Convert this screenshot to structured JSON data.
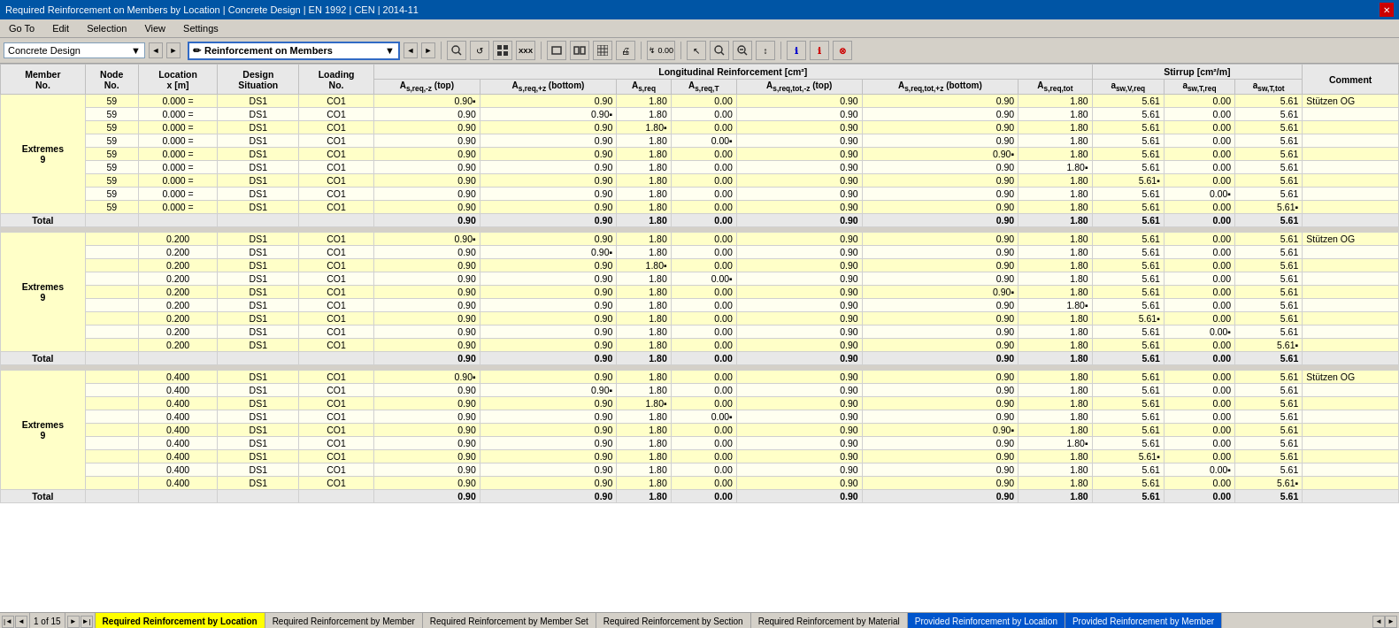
{
  "titleBar": {
    "title": "Required Reinforcement on Members by Location | Concrete Design | EN 1992 | CEN | 2014-11"
  },
  "menuBar": {
    "items": [
      "Go To",
      "Edit",
      "Selection",
      "View",
      "Settings"
    ]
  },
  "toolbar": {
    "dropdown1": "Concrete Design",
    "dropdown2": "Reinforcement on Members",
    "buttons": [
      "⌕",
      "↺",
      "⊞",
      "×××",
      "▭",
      "▭▭",
      "▦",
      "▨",
      "↯",
      "0.00",
      "↖",
      "🔍",
      "🔍",
      "↕",
      "ℹ",
      "ℹ",
      "⊗"
    ]
  },
  "table": {
    "groupHeaders": [
      {
        "label": "Longitudinal Reinforcement [cm²]",
        "colspan": 6
      },
      {
        "label": "Stirrup [cm²/m]",
        "colspan": 3
      }
    ],
    "columns": [
      "Member No.",
      "Node No.",
      "Location x [m]",
      "Design Situation",
      "Loading No.",
      "As,req,-z (top)",
      "As,req,+z (bottom)",
      "As,req",
      "As,req,T",
      "As,req,tot,-z (top)",
      "As,req,tot,+z (bottom)",
      "As,req,tot",
      "asw,V,req",
      "asw,T,req",
      "asw,T,tot",
      "Comment"
    ],
    "sections": [
      {
        "extremes": "Extremes",
        "memberNo": "9",
        "location": "0.000",
        "rows": [
          {
            "node": "59",
            "loc": "0.000 =",
            "ds": "DS1",
            "load": "CO1",
            "asTopReq": "0.90",
            "asBot": "0.90",
            "asReq": "1.80",
            "asT": "0.00",
            "asTopTot": "0.90",
            "asBotTot": "0.90",
            "asTot": "1.80",
            "aswV": "5.61",
            "aswT": "0.00",
            "aswTot": "5.61",
            "comment": "Stützen OG",
            "indTop": true
          },
          {
            "node": "59",
            "loc": "0.000 =",
            "ds": "DS1",
            "load": "CO1",
            "asTopReq": "0.90",
            "asBot": "0.90",
            "asReq": "1.80",
            "asT": "0.00",
            "asTopTot": "0.90",
            "asBotTot": "0.90",
            "asTot": "1.80",
            "aswV": "5.61",
            "aswT": "0.00",
            "aswTot": "5.61",
            "indBot": true
          },
          {
            "node": "59",
            "loc": "0.000 =",
            "ds": "DS1",
            "load": "CO1",
            "asTopReq": "0.90",
            "asBot": "0.90",
            "asReq": "1.80",
            "asT": "0.00",
            "asTopTot": "0.90",
            "asBotTot": "0.90",
            "asTot": "1.80",
            "aswV": "5.61",
            "aswT": "0.00",
            "aswTot": "5.61",
            "indReq": true
          },
          {
            "node": "59",
            "loc": "0.000 =",
            "ds": "DS1",
            "load": "CO1",
            "asTopReq": "0.90",
            "asBot": "0.90",
            "asReq": "1.80",
            "asT": "0.00",
            "asTopTot": "0.90",
            "asBotTot": "0.90",
            "asTot": "1.80",
            "aswV": "5.61",
            "aswT": "0.00",
            "aswTot": "5.61",
            "indAsT": true
          },
          {
            "node": "59",
            "loc": "0.000 =",
            "ds": "DS1",
            "load": "CO1",
            "asTopReq": "0.90",
            "asBot": "0.90",
            "asReq": "1.80",
            "asT": "0.00",
            "asTopTot": "0.90",
            "asBotTot": "0.90",
            "asTot": "1.80",
            "aswV": "5.61",
            "aswT": "0.00",
            "aswTot": "5.61",
            "indBotTot": true
          },
          {
            "node": "59",
            "loc": "0.000 =",
            "ds": "DS1",
            "load": "CO1",
            "asTopReq": "0.90",
            "asBot": "0.90",
            "asReq": "1.80",
            "asT": "0.00",
            "asTopTot": "0.90",
            "asBotTot": "0.90",
            "asTot": "1.80",
            "aswV": "5.61",
            "aswT": "0.00",
            "aswTot": "5.61",
            "indTot": true
          },
          {
            "node": "59",
            "loc": "0.000 =",
            "ds": "DS1",
            "load": "CO1",
            "asTopReq": "0.90",
            "asBot": "0.90",
            "asReq": "1.80",
            "asT": "0.00",
            "asTopTot": "0.90",
            "asBotTot": "0.90",
            "asTot": "1.80",
            "aswV": "5.61",
            "aswT": "0.00",
            "aswTot": "5.61",
            "indAswV": true
          },
          {
            "node": "59",
            "loc": "0.000 =",
            "ds": "DS1",
            "load": "CO1",
            "asTopReq": "0.90",
            "asBot": "0.90",
            "asReq": "1.80",
            "asT": "0.00",
            "asTopTot": "0.90",
            "asBotTot": "0.90",
            "asTot": "1.80",
            "aswV": "5.61",
            "aswT": "0.00",
            "aswTot": "5.61",
            "indAswT": true
          },
          {
            "node": "59",
            "loc": "0.000 =",
            "ds": "DS1",
            "load": "CO1",
            "asTopReq": "0.90",
            "asBot": "0.90",
            "asReq": "1.80",
            "asT": "0.00",
            "asTopTot": "0.90",
            "asBotTot": "0.90",
            "asTot": "1.80",
            "aswV": "5.61",
            "aswT": "0.00",
            "aswTot": "5.61",
            "indAswTot": true
          }
        ],
        "total": {
          "asTopReq": "0.90",
          "asBot": "0.90",
          "asReq": "1.80",
          "asT": "0.00",
          "asTopTot": "0.90",
          "asBotTot": "0.90",
          "asTot": "1.80",
          "aswV": "5.61",
          "aswT": "0.00",
          "aswTot": "5.61"
        }
      },
      {
        "extremes": "Extremes",
        "memberNo": "9",
        "location": "0.200",
        "rows": [
          {
            "node": "",
            "loc": "0.200",
            "ds": "DS1",
            "load": "CO1",
            "asTopReq": "0.90",
            "asBot": "0.90",
            "asReq": "1.80",
            "asT": "0.00",
            "asTopTot": "0.90",
            "asBotTot": "0.90",
            "asTot": "1.80",
            "aswV": "5.61",
            "aswT": "0.00",
            "aswTot": "5.61",
            "comment": "Stützen OG",
            "indTop": true
          },
          {
            "node": "",
            "loc": "0.200",
            "ds": "DS1",
            "load": "CO1",
            "asTopReq": "0.90",
            "asBot": "0.90",
            "asReq": "1.80",
            "asT": "0.00",
            "asTopTot": "0.90",
            "asBotTot": "0.90",
            "asTot": "1.80",
            "aswV": "5.61",
            "aswT": "0.00",
            "aswTot": "5.61",
            "indBot": true
          },
          {
            "node": "",
            "loc": "0.200",
            "ds": "DS1",
            "load": "CO1",
            "asTopReq": "0.90",
            "asBot": "0.90",
            "asReq": "1.80",
            "asT": "0.00",
            "asTopTot": "0.90",
            "asBotTot": "0.90",
            "asTot": "1.80",
            "aswV": "5.61",
            "aswT": "0.00",
            "aswTot": "5.61",
            "indReq": true
          },
          {
            "node": "",
            "loc": "0.200",
            "ds": "DS1",
            "load": "CO1",
            "asTopReq": "0.90",
            "asBot": "0.90",
            "asReq": "1.80",
            "asT": "0.00",
            "asTopTot": "0.90",
            "asBotTot": "0.90",
            "asTot": "1.80",
            "aswV": "5.61",
            "aswT": "0.00",
            "aswTot": "5.61",
            "indAsT": true
          },
          {
            "node": "",
            "loc": "0.200",
            "ds": "DS1",
            "load": "CO1",
            "asTopReq": "0.90",
            "asBot": "0.90",
            "asReq": "1.80",
            "asT": "0.00",
            "asTopTot": "0.90",
            "asBotTot": "0.90",
            "asTot": "1.80",
            "aswV": "5.61",
            "aswT": "0.00",
            "aswTot": "5.61",
            "indBotTot": true
          },
          {
            "node": "",
            "loc": "0.200",
            "ds": "DS1",
            "load": "CO1",
            "asTopReq": "0.90",
            "asBot": "0.90",
            "asReq": "1.80",
            "asT": "0.00",
            "asTopTot": "0.90",
            "asBotTot": "0.90",
            "asTot": "1.80",
            "aswV": "5.61",
            "aswT": "0.00",
            "aswTot": "5.61",
            "indTot": true
          },
          {
            "node": "",
            "loc": "0.200",
            "ds": "DS1",
            "load": "CO1",
            "asTopReq": "0.90",
            "asBot": "0.90",
            "asReq": "1.80",
            "asT": "0.00",
            "asTopTot": "0.90",
            "asBotTot": "0.90",
            "asTot": "1.80",
            "aswV": "5.61",
            "aswT": "0.00",
            "aswTot": "5.61",
            "indAswV": true
          },
          {
            "node": "",
            "loc": "0.200",
            "ds": "DS1",
            "load": "CO1",
            "asTopReq": "0.90",
            "asBot": "0.90",
            "asReq": "1.80",
            "asT": "0.00",
            "asTopTot": "0.90",
            "asBotTot": "0.90",
            "asTot": "1.80",
            "aswV": "5.61",
            "aswT": "0.00",
            "aswTot": "5.61",
            "indAswT": true
          },
          {
            "node": "",
            "loc": "0.200",
            "ds": "DS1",
            "load": "CO1",
            "asTopReq": "0.90",
            "asBot": "0.90",
            "asReq": "1.80",
            "asT": "0.00",
            "asTopTot": "0.90",
            "asBotTot": "0.90",
            "asTot": "1.80",
            "aswV": "5.61",
            "aswT": "0.00",
            "aswTot": "5.61",
            "indAswTot": true
          }
        ],
        "total": {
          "asTopReq": "0.90",
          "asBot": "0.90",
          "asReq": "1.80",
          "asT": "0.00",
          "asTopTot": "0.90",
          "asBotTot": "0.90",
          "asTot": "1.80",
          "aswV": "5.61",
          "aswT": "0.00",
          "aswTot": "5.61"
        }
      },
      {
        "extremes": "Extremes",
        "memberNo": "9",
        "location": "0.400",
        "rows": [
          {
            "node": "",
            "loc": "0.400",
            "ds": "DS1",
            "load": "CO1",
            "asTopReq": "0.90",
            "asBot": "0.90",
            "asReq": "1.80",
            "asT": "0.00",
            "asTopTot": "0.90",
            "asBotTot": "0.90",
            "asTot": "1.80",
            "aswV": "5.61",
            "aswT": "0.00",
            "aswTot": "5.61",
            "comment": "Stützen OG",
            "indTop": true
          },
          {
            "node": "",
            "loc": "0.400",
            "ds": "DS1",
            "load": "CO1",
            "asTopReq": "0.90",
            "asBot": "0.90",
            "asReq": "1.80",
            "asT": "0.00",
            "asTopTot": "0.90",
            "asBotTot": "0.90",
            "asTot": "1.80",
            "aswV": "5.61",
            "aswT": "0.00",
            "aswTot": "5.61",
            "indBot": true
          },
          {
            "node": "",
            "loc": "0.400",
            "ds": "DS1",
            "load": "CO1",
            "asTopReq": "0.90",
            "asBot": "0.90",
            "asReq": "1.80",
            "asT": "0.00",
            "asTopTot": "0.90",
            "asBotTot": "0.90",
            "asTot": "1.80",
            "aswV": "5.61",
            "aswT": "0.00",
            "aswTot": "5.61",
            "indReq": true
          },
          {
            "node": "",
            "loc": "0.400",
            "ds": "DS1",
            "load": "CO1",
            "asTopReq": "0.90",
            "asBot": "0.90",
            "asReq": "1.80",
            "asT": "0.00",
            "asTopTot": "0.90",
            "asBotTot": "0.90",
            "asTot": "1.80",
            "aswV": "5.61",
            "aswT": "0.00",
            "aswTot": "5.61",
            "indAsT": true
          },
          {
            "node": "",
            "loc": "0.400",
            "ds": "DS1",
            "load": "CO1",
            "asTopReq": "0.90",
            "asBot": "0.90",
            "asReq": "1.80",
            "asT": "0.00",
            "asTopTot": "0.90",
            "asBotTot": "0.90",
            "asTot": "1.80",
            "aswV": "5.61",
            "aswT": "0.00",
            "aswTot": "5.61",
            "indBotTot": true
          },
          {
            "node": "",
            "loc": "0.400",
            "ds": "DS1",
            "load": "CO1",
            "asTopReq": "0.90",
            "asBot": "0.90",
            "asReq": "1.80",
            "asT": "0.00",
            "asTopTot": "0.90",
            "asBotTot": "0.90",
            "asTot": "1.80",
            "aswV": "5.61",
            "aswT": "0.00",
            "aswTot": "5.61",
            "indTot": true
          },
          {
            "node": "",
            "loc": "0.400",
            "ds": "DS1",
            "load": "CO1",
            "asTopReq": "0.90",
            "asBot": "0.90",
            "asReq": "1.80",
            "asT": "0.00",
            "asTopTot": "0.90",
            "asBotTot": "0.90",
            "asTot": "1.80",
            "aswV": "5.61",
            "aswT": "0.00",
            "aswTot": "5.61",
            "indAswV": true
          },
          {
            "node": "",
            "loc": "0.400",
            "ds": "DS1",
            "load": "CO1",
            "asTopReq": "0.90",
            "asBot": "0.90",
            "asReq": "1.80",
            "asT": "0.00",
            "asTopTot": "0.90",
            "asBotTot": "0.90",
            "asTot": "1.80",
            "aswV": "5.61",
            "aswT": "0.00",
            "aswTot": "5.61",
            "indAswT": true
          },
          {
            "node": "",
            "loc": "0.400",
            "ds": "DS1",
            "load": "CO1",
            "asTopReq": "0.90",
            "asBot": "0.90",
            "asReq": "1.80",
            "asT": "0.00",
            "asTopTot": "0.90",
            "asBotTot": "0.90",
            "asTot": "1.80",
            "aswV": "5.61",
            "aswT": "0.00",
            "aswTot": "5.61",
            "indAswTot": true
          }
        ],
        "total": {
          "asTopReq": "0.90",
          "asBot": "0.90",
          "asReq": "1.80",
          "asT": "0.00",
          "asTopTot": "0.90",
          "asBotTot": "0.90",
          "asTot": "1.80",
          "aswV": "5.61",
          "aswT": "0.00",
          "aswTot": "5.61"
        }
      }
    ]
  },
  "bottomTabs": {
    "pageInfo": "1 of 15",
    "tabs": [
      {
        "label": "Required Reinforcement by Location",
        "active": true,
        "yellow": true
      },
      {
        "label": "Required Reinforcement by Member",
        "active": false
      },
      {
        "label": "Required Reinforcement by Member Set",
        "active": false
      },
      {
        "label": "Required Reinforcement by Section",
        "active": false
      },
      {
        "label": "Required Reinforcement by Material",
        "active": false
      },
      {
        "label": "Provided Reinforcement by Location",
        "active": false,
        "blue": true
      },
      {
        "label": "Provided Reinforcement by Member",
        "active": false,
        "blue": true
      }
    ]
  }
}
